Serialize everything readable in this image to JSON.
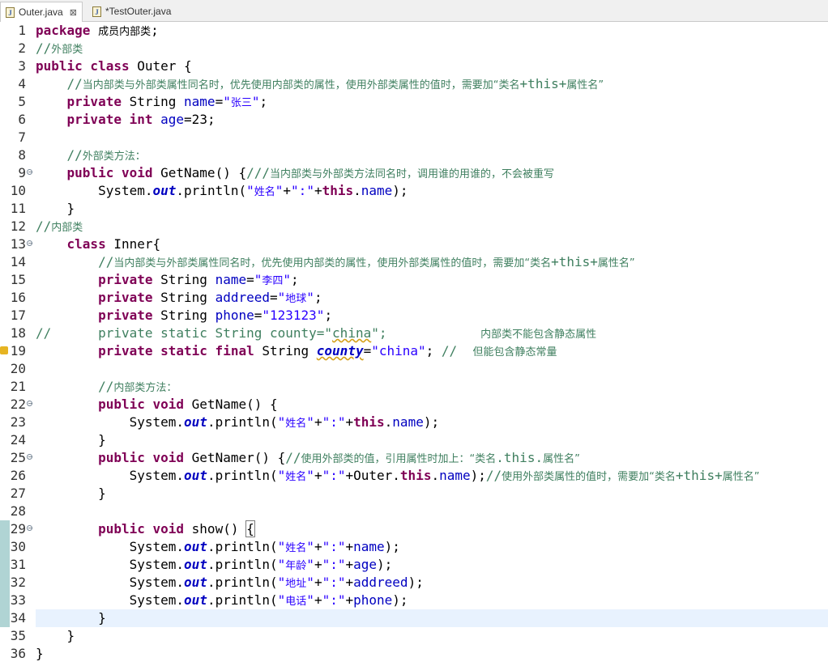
{
  "tabs": [
    {
      "label": "Outer.java",
      "active": true,
      "close": "⊠"
    },
    {
      "label": "*TestOuter.java",
      "active": false
    }
  ],
  "editor": {
    "current_line": 34,
    "lines": [
      {
        "n": "1",
        "html": "<span class='kw'>package</span> <span class='cjk'>成员内部类</span>;"
      },
      {
        "n": "2",
        "html": "<span class='cm'>//<span class='cjk'>外部类</span></span>"
      },
      {
        "n": "3",
        "html": "<span class='kw'>public class</span> Outer {"
      },
      {
        "n": "4",
        "html": "    <span class='cm'>//<span class='cjk'>当内部类与外部类属性同名时，优先使用内部类的属性，使用外部类属性的值时，需要加“类名</span>+this+<span class='cjk'>属性名”</span></span>"
      },
      {
        "n": "5",
        "html": "    <span class='kw'>private</span> String <span class='fd'>name</span>=<span class='st'>\"<span class='cjk'>张三</span>\"</span>;"
      },
      {
        "n": "6",
        "html": "    <span class='kw'>private int</span> <span class='fd'>age</span>=23;"
      },
      {
        "n": "7",
        "html": ""
      },
      {
        "n": "8",
        "html": "    <span class='cm'>//<span class='cjk'>外部类方法：</span></span>"
      },
      {
        "n": "9",
        "fold": true,
        "html": "    <span class='kw'>public void</span> GetName() {<span class='cm'>///<span class='cjk'>当内部类与外部类方法同名时，调用谁的用谁的，不会被重写</span></span>"
      },
      {
        "n": "10",
        "html": "        System.<span class='sf'>out</span>.println(<span class='st'>\"<span class='cjk'>姓名</span>\"</span>+<span class='st'>\":\"</span>+<span class='kw'>this</span>.<span class='fd'>name</span>);"
      },
      {
        "n": "11",
        "html": "    }"
      },
      {
        "n": "12",
        "html": "<span class='cm'>//<span class='cjk'>内部类</span></span>"
      },
      {
        "n": "13",
        "fold": true,
        "html": "    <span class='kw'>class</span> Inner{"
      },
      {
        "n": "14",
        "html": "        <span class='cm'>//<span class='cjk'>当内部类与外部类属性同名时，优先使用内部类的属性，使用外部类属性的值时，需要加“类名</span>+this+<span class='cjk'>属性名”</span></span>"
      },
      {
        "n": "15",
        "html": "        <span class='kw'>private</span> String <span class='fd'>name</span>=<span class='st'>\"<span class='cjk'>李四</span>\"</span>;"
      },
      {
        "n": "16",
        "html": "        <span class='kw'>private</span> String <span class='fd'>addreed</span>=<span class='st'>\"<span class='cjk'>地球</span>\"</span>;"
      },
      {
        "n": "17",
        "html": "        <span class='kw'>private</span> String <span class='fd'>phone</span>=<span class='st'>\"123123\"</span>;"
      },
      {
        "n": "18",
        "html": "<span class='cm'>//      private static String county=\"<span class='squiggle'>china</span>\";            <span class='cjk'>内部类不能包含静态属性</span></span>"
      },
      {
        "n": "19",
        "warn": true,
        "html": "        <span class='kw'>private static final</span> String <span class='so squiggle'>county</span>=<span class='st'>\"china\"</span>; <span class='cm'>//  <span class='cjk'>但能包含静态常量</span></span>"
      },
      {
        "n": "20",
        "html": ""
      },
      {
        "n": "21",
        "html": "        <span class='cm'>//<span class='cjk'>内部类方法：</span></span>"
      },
      {
        "n": "22",
        "fold": true,
        "html": "        <span class='kw'>public void</span> GetName() {"
      },
      {
        "n": "23",
        "html": "            System.<span class='sf'>out</span>.println(<span class='st'>\"<span class='cjk'>姓名</span>\"</span>+<span class='st'>\":\"</span>+<span class='kw'>this</span>.<span class='fd'>name</span>);"
      },
      {
        "n": "24",
        "html": "        }"
      },
      {
        "n": "25",
        "fold": true,
        "html": "        <span class='kw'>public void</span> GetNamer() {<span class='cm'>//<span class='cjk'>使用外部类的值，引用属性时加上：“类名</span>.this.<span class='cjk'>属性名”</span></span>"
      },
      {
        "n": "26",
        "html": "            System.<span class='sf'>out</span>.println(<span class='st'>\"<span class='cjk'>姓名</span>\"</span>+<span class='st'>\":\"</span>+Outer.<span class='kw'>this</span>.<span class='fd'>name</span>);<span class='cm'>//<span class='cjk'>使用外部类属性的值时，需要加“类名</span>+this+<span class='cjk'>属性名”</span></span>"
      },
      {
        "n": "27",
        "html": "        }"
      },
      {
        "n": "28",
        "html": ""
      },
      {
        "n": "29",
        "fold": true,
        "html": "        <span class='kw'>public void</span> show() <span class='bracket-box'>{</span>"
      },
      {
        "n": "30",
        "html": "            System.<span class='sf'>out</span>.println(<span class='st'>\"<span class='cjk'>姓名</span>\"</span>+<span class='st'>\":\"</span>+<span class='fd'>name</span>);"
      },
      {
        "n": "31",
        "html": "            System.<span class='sf'>out</span>.println(<span class='st'>\"<span class='cjk'>年龄</span>\"</span>+<span class='st'>\":\"</span>+<span class='fd'>age</span>);"
      },
      {
        "n": "32",
        "html": "            System.<span class='sf'>out</span>.println(<span class='st'>\"<span class='cjk'>地址</span>\"</span>+<span class='st'>\":\"</span>+<span class='fd'>addreed</span>);"
      },
      {
        "n": "33",
        "html": "            System.<span class='sf'>out</span>.println(<span class='st'>\"<span class='cjk'>电话</span>\"</span>+<span class='st'>\":\"</span>+<span class='fd'>phone</span>);"
      },
      {
        "n": "34",
        "html": "        }"
      },
      {
        "n": "35",
        "html": "    }"
      },
      {
        "n": "36",
        "html": "}"
      }
    ]
  },
  "colors": {
    "keyword": "#7f0055",
    "comment": "#3f7f5f",
    "string": "#2a00ff",
    "field": "#0000c0",
    "current_line": "#e8f2fe",
    "change_bar": "#6fb1b1"
  }
}
